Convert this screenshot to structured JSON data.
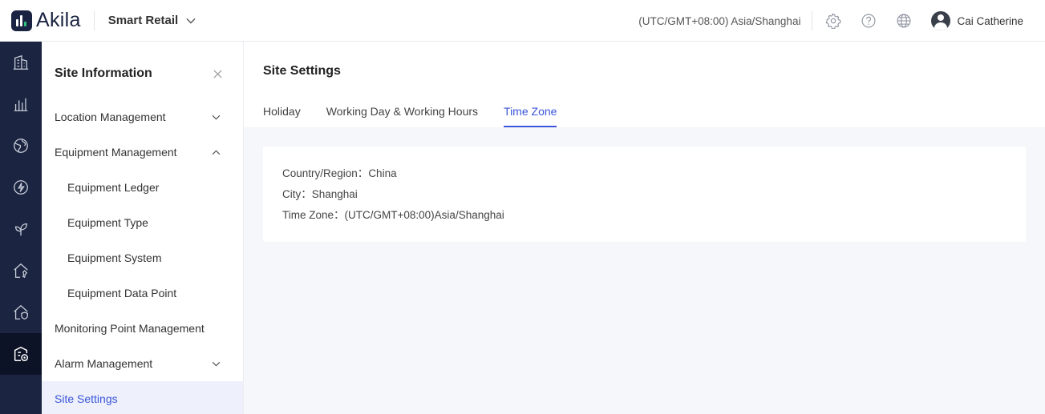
{
  "header": {
    "logo_text": "Akila",
    "app_name": "Smart Retail",
    "timezone": "(UTC/GMT+08:00) Asia/Shanghai",
    "icons": [
      "gear-icon",
      "help-icon",
      "globe-icon"
    ],
    "user_name": "Cai Catherine"
  },
  "rail": {
    "icons": [
      "building-icon",
      "bar-chart-icon",
      "globe-leaf-icon",
      "energy-icon",
      "leaf-icon",
      "house-wrench-icon",
      "house-shield-icon",
      "site-settings-icon"
    ],
    "active_index": 7
  },
  "sidebar": {
    "title": "Site Information",
    "items": [
      {
        "label": "Location Management",
        "chevron": "down"
      },
      {
        "label": "Equipment Management",
        "chevron": "up"
      },
      {
        "label": "Equipment Ledger",
        "sub": true
      },
      {
        "label": "Equipment Type",
        "sub": true
      },
      {
        "label": "Equipment System",
        "sub": true
      },
      {
        "label": "Equipment Data Point",
        "sub": true
      },
      {
        "label": "Monitoring Point Management"
      },
      {
        "label": "Alarm Management",
        "chevron": "down"
      },
      {
        "label": "Site Settings",
        "active": true
      }
    ]
  },
  "main": {
    "title": "Site Settings",
    "tabs": [
      {
        "label": "Holiday"
      },
      {
        "label": "Working Day & Working Hours"
      },
      {
        "label": "Time Zone",
        "active": true
      }
    ],
    "fields": [
      {
        "label": "Country/Region：",
        "value": "China"
      },
      {
        "label": "City：",
        "value": "Shanghai"
      },
      {
        "label": "Time Zone：",
        "value": "(UTC/GMT+08:00)Asia/Shanghai"
      }
    ]
  },
  "colors": {
    "accent": "#3a55d9",
    "rail_bg": "#1b2440",
    "rail_active_bg": "#0d1326",
    "page_bg": "#f6f7fb"
  }
}
